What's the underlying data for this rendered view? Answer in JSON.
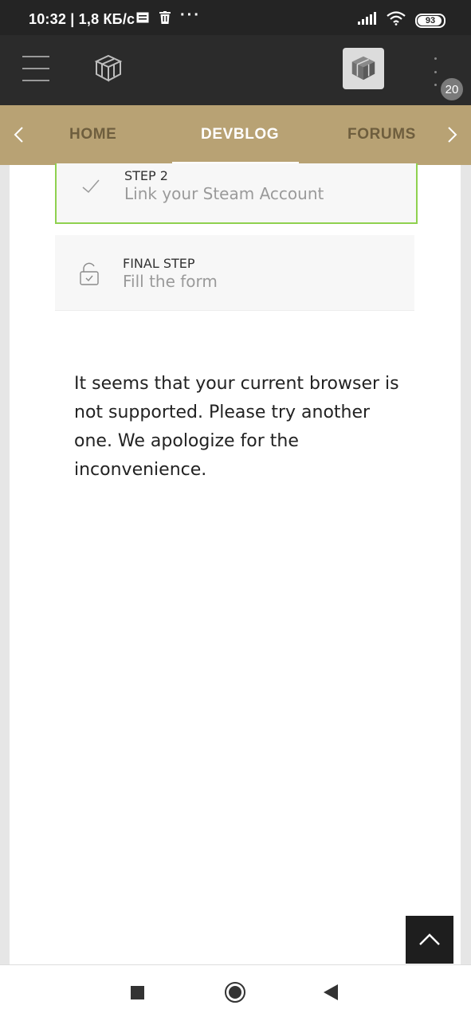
{
  "status_bar": {
    "time_speed": "10:32 | 1,8 КБ/с",
    "battery": "93",
    "icons": [
      "message-icon",
      "trash-icon",
      "more-dots-icon",
      "signal-icon",
      "wifi-icon",
      "battery-icon"
    ]
  },
  "header": {
    "notification_count": "20"
  },
  "nav": {
    "tabs": [
      {
        "label": "HOME"
      },
      {
        "label": "DEVBLOG"
      },
      {
        "label": "FORUMS"
      }
    ],
    "active_tab": "DEVBLOG"
  },
  "steps": {
    "step2": {
      "label": "STEP 2",
      "title": "Link your Steam Account"
    },
    "final": {
      "label": "FINAL STEP",
      "title": "Fill the form"
    }
  },
  "main": {
    "message": "It seems that your current browser is not supported. Please try another one. We apologize for the inconvenience."
  },
  "colors": {
    "nav_bar": "#b8a274",
    "header_bg": "#2b2b2b",
    "step_complete_border": "#8fd14f"
  }
}
